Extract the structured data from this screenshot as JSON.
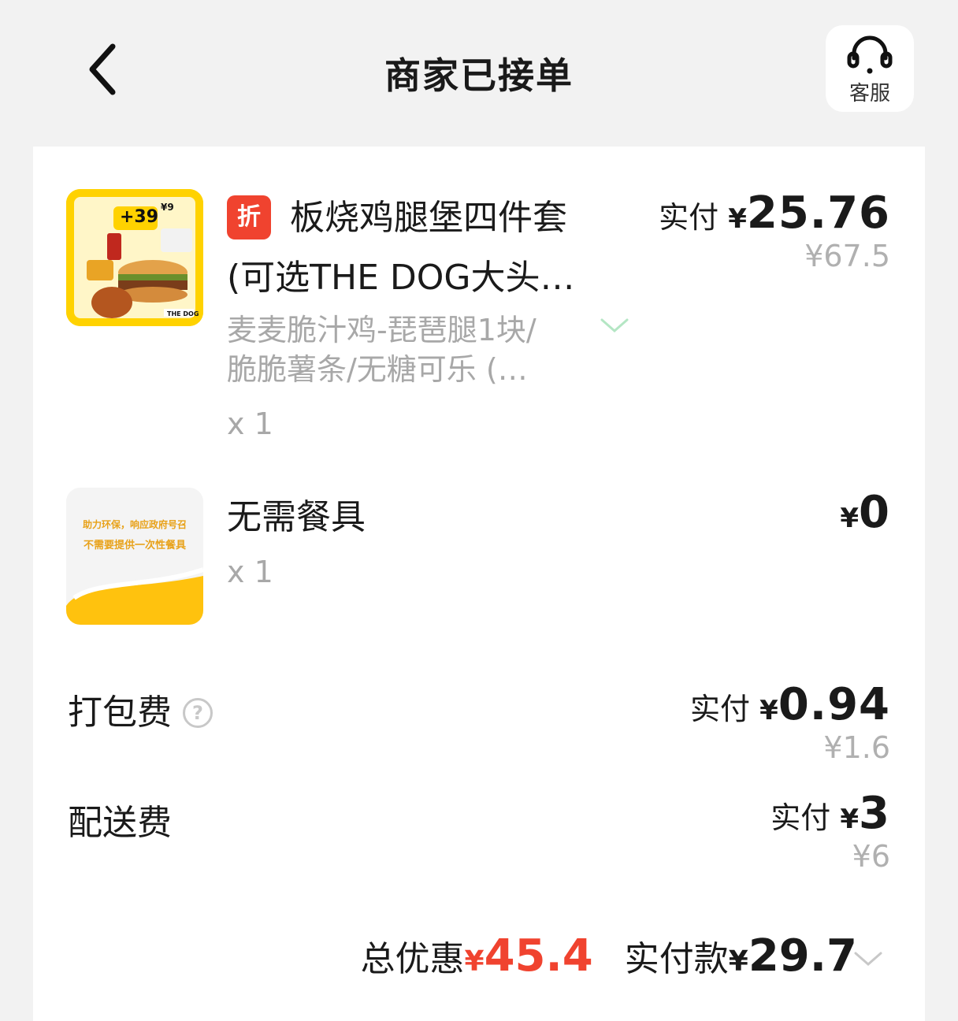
{
  "header": {
    "back_icon": "chevron-left-icon",
    "title": "商家已接单",
    "service": {
      "icon": "headset-icon",
      "label": "客服"
    }
  },
  "items": [
    {
      "tag": "折",
      "name_line1": "板烧鸡腿堡四件套",
      "name_line2": "(可选THE DOG大头…",
      "spec_line1": "麦麦脆汁鸡-琵琶腿1块/",
      "spec_line2": "脆脆薯条/无糖可乐 (…",
      "qty": "x 1",
      "pay_label": "实付",
      "currency": "¥",
      "pay_amount": "25.76",
      "original_price": "¥67.5",
      "thumb": {
        "price_badge": "+39",
        "price_suffix": "¥9",
        "brand": "THE DOG"
      }
    },
    {
      "name": "无需餐具",
      "qty": "x 1",
      "currency": "¥",
      "pay_amount": "0",
      "thumb": {
        "line1": "助力环保，响应政府号召",
        "line2": "不需要提供一次性餐具"
      }
    }
  ],
  "fees": [
    {
      "label": "打包费",
      "help": "?",
      "pay_label": "实付",
      "currency": "¥",
      "pay_amount": "0.94",
      "original_price": "¥1.6"
    },
    {
      "label": "配送费",
      "pay_label": "实付",
      "currency": "¥",
      "pay_amount": "3",
      "original_price": "¥6"
    }
  ],
  "summary": {
    "discount_label": "总优惠",
    "discount_currency": "¥",
    "discount_amount": "45.4",
    "pay_label": "实付款",
    "pay_currency": "¥",
    "pay_amount": "29.7"
  },
  "colors": {
    "accent_red": "#f0432f",
    "brand_yellow": "#ffd200",
    "page_bg": "#f2f2f2"
  }
}
